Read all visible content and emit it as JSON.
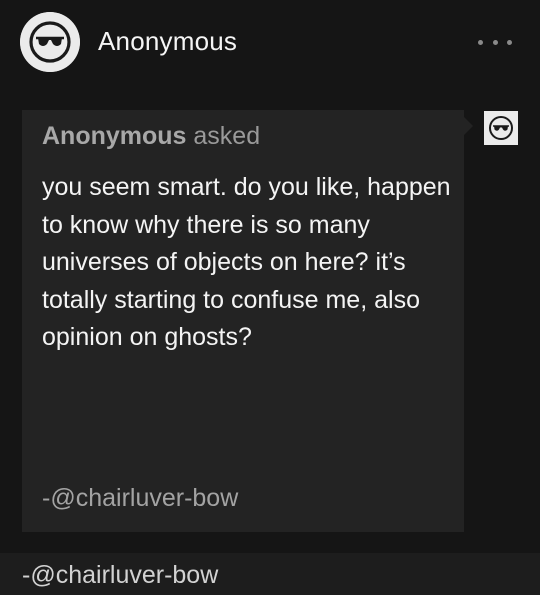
{
  "post": {
    "author": "Anonymous",
    "more_icon": "ellipsis-icon",
    "avatar_icon": "anonymous-sunglasses-icon"
  },
  "ask": {
    "asker_name": "Anonymous",
    "asked_label": "asked",
    "question": "you seem smart. do you like, happen to know why there is so many universes of objects on here? it’s totally starting to confuse me, also opinion on ghosts?",
    "signature": "-@chairluver-bow",
    "asker_avatar_icon": "anonymous-sunglasses-icon"
  },
  "answer": {
    "text": "-@chairluver-bow"
  },
  "colors": {
    "background": "#151515",
    "bubble": "#232323",
    "avatar_bg": "#ebebeb"
  }
}
